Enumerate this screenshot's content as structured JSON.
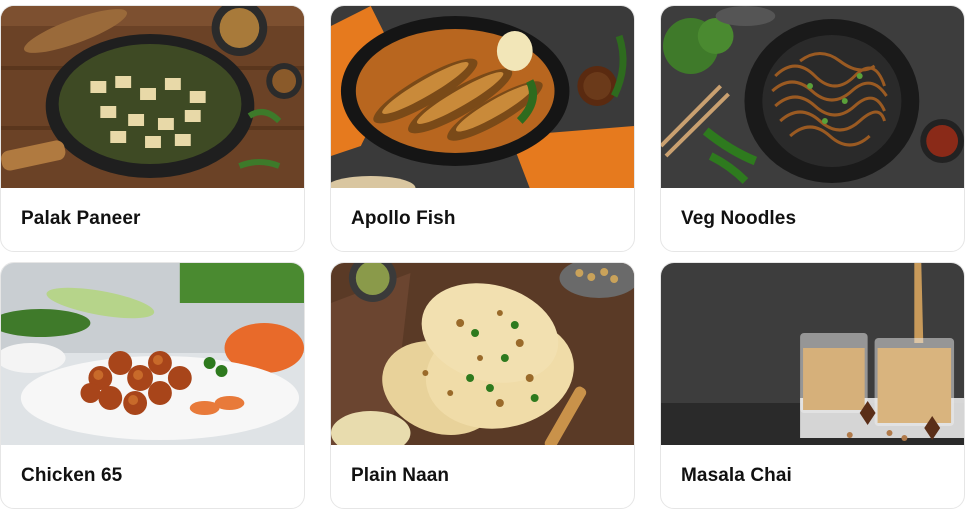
{
  "dishes": [
    {
      "name": "Palak Paneer",
      "image": "palak-paneer-photo"
    },
    {
      "name": "Apollo Fish",
      "image": "apollo-fish-photo"
    },
    {
      "name": "Veg Noodles",
      "image": "veg-noodles-photo"
    },
    {
      "name": "Chicken 65",
      "image": "chicken-65-photo"
    },
    {
      "name": "Plain Naan",
      "image": "plain-naan-photo"
    },
    {
      "name": "Masala Chai",
      "image": "masala-chai-photo"
    }
  ]
}
